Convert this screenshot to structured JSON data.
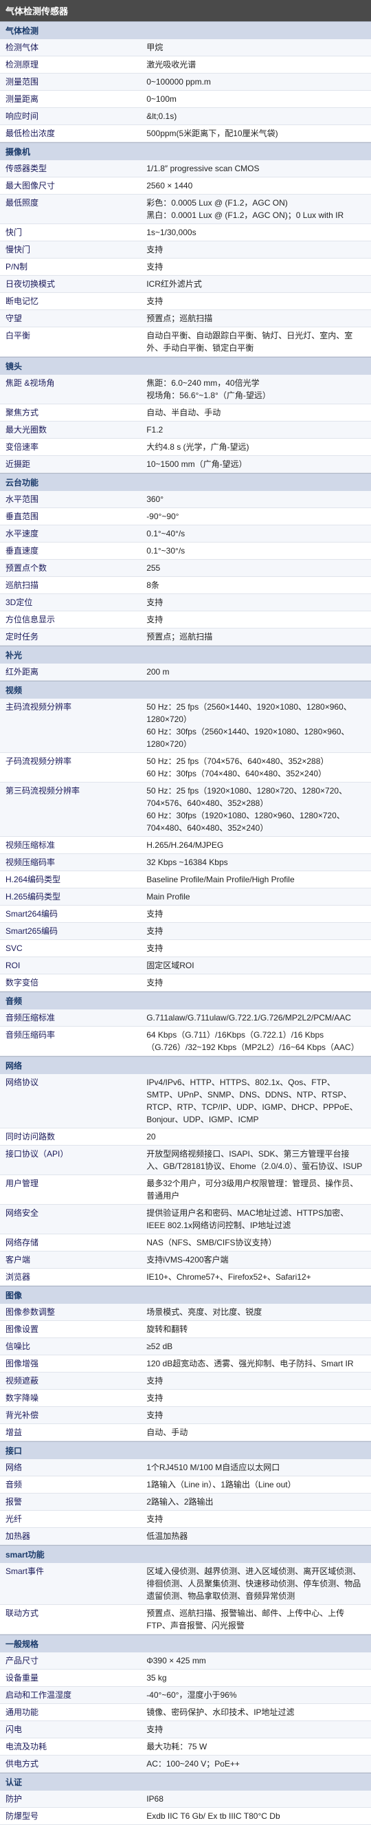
{
  "title": "气体检测传感器",
  "sections": [
    {
      "name": "气体检测",
      "rows": [
        [
          "检测气体",
          "甲烷"
        ],
        [
          "检测原理",
          "激光吸收光谱"
        ],
        [
          "测量范围",
          "0~100000 ppm.m"
        ],
        [
          "测量距离",
          "0~100m"
        ],
        [
          "响应时间",
          "&lt;0.1s)"
        ],
        [
          "最低检出浓度",
          "500ppm(5米距离下，配10厘米气袋)"
        ]
      ]
    },
    {
      "name": "摄像机",
      "rows": [
        [
          "传感器类型",
          "1/1.8″ progressive scan CMOS"
        ],
        [
          "最大图像尺寸",
          "2560 × 1440"
        ],
        [
          "最低照度",
          "彩色：0.0005 Lux @ (F1.2，AGC ON)\n黑白：0.0001 Lux @ (F1.2，AGC ON)；0 Lux with IR"
        ],
        [
          "快门",
          "1s~1/30,000s"
        ],
        [
          "慢快门",
          "支持"
        ],
        [
          "P/N制",
          "支持"
        ],
        [
          "日夜切换模式",
          "ICR红外滤片式"
        ],
        [
          "断电记忆",
          "支持"
        ],
        [
          "守望",
          "预置点；巡航扫描"
        ],
        [
          "白平衡",
          "自动白平衡、自动跟踪白平衡、钠灯、日光灯、室内、室外、手动白平衡、锁定白平衡"
        ]
      ]
    },
    {
      "name": "镜头",
      "rows": [
        [
          "焦距 &视场角",
          "焦距：6.0~240 mm，40倍光学\n视场角：56.6°~1.8°（广角-望远）"
        ],
        [
          "聚焦方式",
          "自动、半自动、手动"
        ],
        [
          "最大光圈数",
          "F1.2"
        ],
        [
          "变倍速率",
          "大约4.8 s (光学，广角-望远)"
        ],
        [
          "近摄距",
          "10~1500 mm（广角-望远）"
        ]
      ]
    },
    {
      "name": "云台功能",
      "rows": [
        [
          "水平范围",
          "360°"
        ],
        [
          "垂直范围",
          "-90°~90°"
        ],
        [
          "水平速度",
          "0.1°~40°/s"
        ],
        [
          "垂直速度",
          "0.1°~30°/s"
        ],
        [
          "预置点个数",
          "255"
        ],
        [
          "巡航扫描",
          "8条"
        ],
        [
          "3D定位",
          "支持"
        ],
        [
          "方位信息显示",
          "支持"
        ],
        [
          "定时任务",
          "预置点；巡航扫描"
        ]
      ]
    },
    {
      "name": "补光",
      "rows": [
        [
          "红外距离",
          "200 m"
        ]
      ]
    },
    {
      "name": "视频",
      "rows": [
        [
          "主码流视频分辨率",
          "50 Hz：25 fps（2560×1440、1920×1080、1280×960、1280×720）\n60 Hz：30fps（2560×1440、1920×1080、1280×960、1280×720）"
        ],
        [
          "子码流视频分辨率",
          "50 Hz：25 fps（704×576、640×480、352×288）\n60 Hz：30fps（704×480、640×480、352×240）"
        ],
        [
          "第三码流视频分辨率",
          "50 Hz：25 fps（1920×1080、1280×720、1280×720、704×576、640×480、352×288）\n60 Hz：30fps（1920×1080、1280×960、1280×720、704×480、640×480、352×240）"
        ],
        [
          "视频压缩标准",
          "H.265/H.264/MJPEG"
        ],
        [
          "视频压缩码率",
          "32 Kbps ~16384 Kbps"
        ],
        [
          "H.264编码类型",
          "Baseline Profile/Main Profile/High Profile"
        ],
        [
          "H.265编码类型",
          "Main Profile"
        ],
        [
          "Smart264编码",
          "支持"
        ],
        [
          "Smart265编码",
          "支持"
        ],
        [
          "SVC",
          "支持"
        ],
        [
          "ROI",
          "固定区域ROI"
        ],
        [
          "数字变倍",
          "支持"
        ]
      ]
    },
    {
      "name": "音频",
      "rows": [
        [
          "音频压缩标准",
          "G.711alaw/G.711ulaw/G.722.1/G.726/MP2L2/PCM/AAC"
        ],
        [
          "音频压缩码率",
          "64 Kbps（G.711）/16Kbps（G.722.1）/16 Kbps（G.726）/32~192 Kbps（MP2L2）/16~64 Kbps（AAC）"
        ]
      ]
    },
    {
      "name": "网络",
      "rows": [
        [
          "网络协议",
          "IPv4/IPv6、HTTP、HTTPS、802.1x、Qos、FTP、SMTP、UPnP、SNMP、DNS、DDNS、NTP、RTSP、RTCP、RTP、TCP/IP、UDP、IGMP、DHCP、PPPoE、Bonjour、UDP、IGMP、ICMP"
        ],
        [
          "同时访问路数",
          "20"
        ],
        [
          "接口协议（API）",
          "开放型网络视频接口、ISAPI、SDK、第三方管理平台接入、GB/T28181协议、Ehome（2.0/4.0）、萤石协议、ISUP"
        ],
        [
          "用户管理",
          "最多32个用户，可分3级用户权限管理：管理员、操作员、普通用户"
        ],
        [
          "网络安全",
          "提供验证用户名和密码、MAC地址过滤、HTTPS加密、IEEE 802.1x网络访问控制、IP地址过滤"
        ],
        [
          "网络存储",
          "NAS（NFS、SMB/CIFS协议支持）"
        ],
        [
          "客户端",
          "支持iVMS-4200客户端"
        ],
        [
          "浏览器",
          "IE10+、Chrome57+、Firefox52+、Safari12+"
        ]
      ]
    },
    {
      "name": "图像",
      "rows": [
        [
          "图像参数调整",
          "场景模式、亮度、对比度、锐度"
        ],
        [
          "图像设置",
          "旋转和翻转"
        ],
        [
          "信噪比",
          "≥52 dB"
        ],
        [
          "图像增强",
          "120 dB超宽动态、透雾、强光抑制、电子防抖、Smart IR"
        ],
        [
          "视频遮蔽",
          "支持"
        ],
        [
          "数字降噪",
          "支持"
        ],
        [
          "背光补偿",
          "支持"
        ],
        [
          "增益",
          "自动、手动"
        ]
      ]
    },
    {
      "name": "接口",
      "rows": [
        [
          "网络",
          "1个RJ4510 M/100 M自适应以太网口"
        ],
        [
          "音频",
          "1路输入（Line in）、1路输出（Line out）"
        ],
        [
          "报警",
          "2路输入、2路输出"
        ],
        [
          "光纤",
          "支持"
        ],
        [
          "加热器",
          "低温加热器"
        ]
      ]
    },
    {
      "name": "smart功能",
      "rows": [
        [
          "Smart事件",
          "区域入侵侦测、越界侦测、进入区域侦测、离开区域侦测、徘徊侦测、人员聚集侦测、快速移动侦测、停车侦测、物品遗留侦测、物品拿取侦测、音频异常侦测"
        ],
        [
          "联动方式",
          "预置点、巡航扫描、报警输出、邮件、上传中心、上传FTP、声音报警、闪光报警"
        ]
      ]
    },
    {
      "name": "一般规格",
      "rows": [
        [
          "产品尺寸",
          "Φ390 × 425 mm"
        ],
        [
          "设备重量",
          "35 kg"
        ],
        [
          "启动和工作温湿度",
          "-40°~60°，湿度小于96%"
        ],
        [
          "通用功能",
          "镜像、密码保护、水印技术、IP地址过滤"
        ],
        [
          "闪电",
          "支持"
        ],
        [
          "电流及功耗",
          "最大功耗：75 W"
        ],
        [
          "供电方式",
          "AC：100~240 V；PoE++"
        ]
      ]
    },
    {
      "name": "认证",
      "rows": [
        [
          "防护",
          "IP68"
        ],
        [
          "防爆型号",
          "Exdb IIC T6 Gb/ Ex tb IIIC T80°C Db"
        ]
      ]
    }
  ]
}
